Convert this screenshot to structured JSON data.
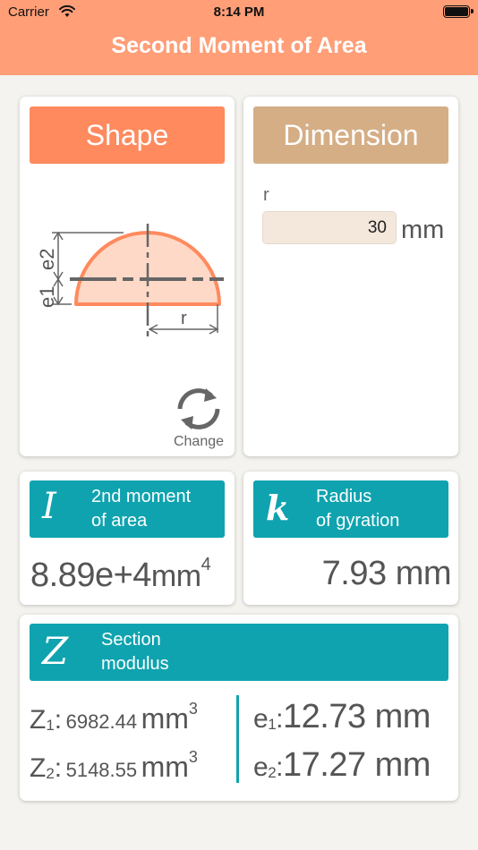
{
  "status_bar": {
    "carrier": "Carrier",
    "time": "8:14 PM"
  },
  "header": {
    "title": "Second Moment of Area"
  },
  "shape_card": {
    "button_label": "Shape",
    "diagram": {
      "label_e1": "e1",
      "label_e2": "e2",
      "label_r": "r"
    },
    "change_label": "Change"
  },
  "dimension_card": {
    "button_label": "Dimension",
    "field_label": "r",
    "field_value": "30",
    "unit": "mm"
  },
  "moment_card": {
    "symbol": "I",
    "line1": "2nd moment",
    "line2": "of area",
    "value": "8.89e+4",
    "unit": "mm",
    "unit_exp": "4"
  },
  "gyration_card": {
    "symbol": "k",
    "line1": "Radius",
    "line2": "of gyration",
    "value": "7.93",
    "unit": "mm"
  },
  "modulus_card": {
    "symbol": "Z",
    "line1": "Section",
    "line2": "modulus",
    "z1": {
      "label": "Z",
      "sub": "1",
      "value": "6982.44",
      "unit": "mm",
      "unit_exp": "3"
    },
    "z2": {
      "label": "Z",
      "sub": "2",
      "value": "5148.55",
      "unit": "mm",
      "unit_exp": "3"
    },
    "e1": {
      "label": "e",
      "sub": "1",
      "value": "12.73",
      "unit": "mm"
    },
    "e2": {
      "label": "e",
      "sub": "2",
      "value": "17.27",
      "unit": "mm"
    }
  },
  "colors": {
    "header_bg": "#ff9e77",
    "shape_button": "#ff8a5e",
    "dimension_button": "#d5ae86",
    "teal": "#0fa3af",
    "shape_fill": "#ffd9c7",
    "shape_stroke": "#ff8a5e"
  }
}
